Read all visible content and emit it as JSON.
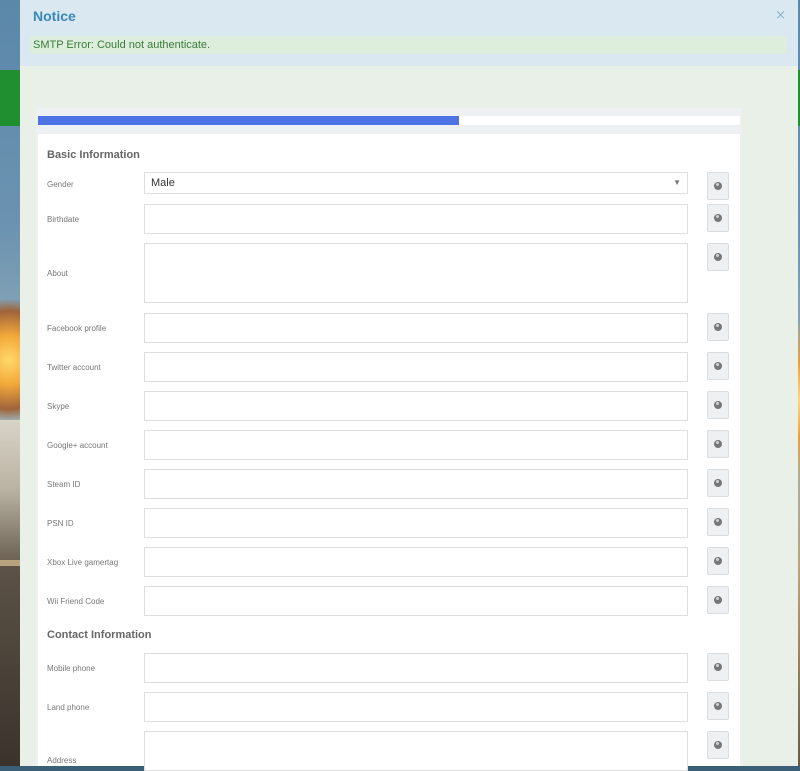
{
  "notice": {
    "title": "Notice",
    "close_symbol": "×",
    "error_message": "SMTP Error: Could not authenticate."
  },
  "progress": {
    "percent": 60
  },
  "sections": {
    "basic": {
      "title": "Basic Information",
      "fields": [
        {
          "label": "Gender",
          "type": "select",
          "value": "Male"
        },
        {
          "label": "Birthdate",
          "type": "text",
          "value": ""
        },
        {
          "label": "About",
          "type": "textarea",
          "value": ""
        },
        {
          "label": "Facebook profile",
          "type": "text",
          "value": ""
        },
        {
          "label": "Twitter account",
          "type": "text",
          "value": ""
        },
        {
          "label": "Skype",
          "type": "text",
          "value": ""
        },
        {
          "label": "Google+ account",
          "type": "text",
          "value": ""
        },
        {
          "label": "Steam ID",
          "type": "text",
          "value": ""
        },
        {
          "label": "PSN ID",
          "type": "text",
          "value": ""
        },
        {
          "label": "Xbox Live gamertag",
          "type": "text",
          "value": ""
        },
        {
          "label": "Wii Friend Code",
          "type": "text",
          "value": ""
        }
      ]
    },
    "contact": {
      "title": "Contact Information",
      "fields": [
        {
          "label": "Mobile phone",
          "type": "text",
          "value": ""
        },
        {
          "label": "Land phone",
          "type": "text",
          "value": ""
        },
        {
          "label": "Address",
          "type": "text",
          "value": ""
        }
      ]
    }
  },
  "icons": {
    "visibility": "globe-icon",
    "dropdown": "caret-down-icon"
  },
  "colors": {
    "notice_title": "#3a87b9",
    "error_text": "#3c7a39",
    "progress_fill": "#4d73e4"
  }
}
